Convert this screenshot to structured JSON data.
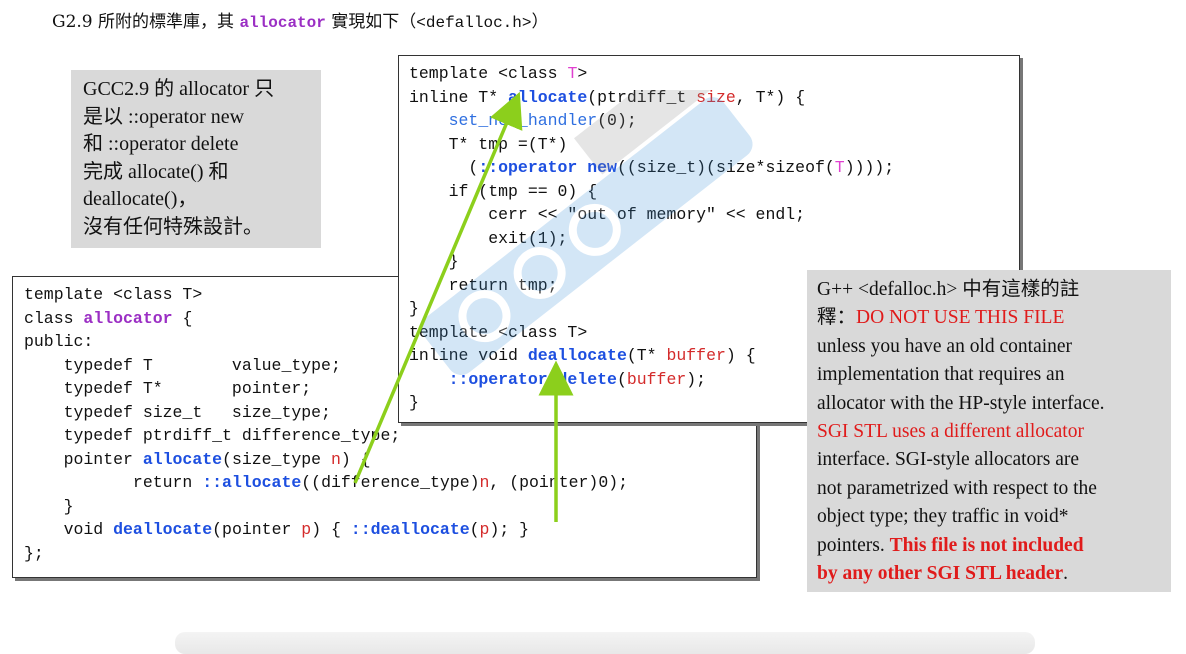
{
  "heading": {
    "prefix": "G2.9 所附的標準庫，其 ",
    "keyword": "allocator",
    "middle": " 實現如下（",
    "file": "<defalloc.h>",
    "suffix": "）"
  },
  "note_left": {
    "lines": [
      "GCC2.9 的 allocator 只",
      "是以 ::operator new",
      "和 ::operator delete",
      "完成 allocate() 和",
      "deallocate()，",
      "沒有任何特殊設計。"
    ]
  },
  "code_top": {
    "tokens": [
      [
        "template <class ",
        "T",
        ">"
      ],
      [
        "inline T* ",
        "allocate",
        "(ptrdiff_t ",
        "size",
        ", T*) {"
      ],
      [
        "    ",
        "set_new_handler",
        "(0);"
      ],
      [
        "    T* tmp =(T*)"
      ],
      [
        "      (",
        "::operator new",
        "((size_t)(size*sizeof(",
        "T",
        "))));"
      ],
      [
        "    if (tmp == 0) {"
      ],
      [
        "        cerr << \"out of memory\" << endl;"
      ],
      [
        "        exit(1);"
      ],
      [
        "    }"
      ],
      [
        "    return tmp;"
      ],
      [
        "}"
      ],
      [
        "template <class T>"
      ],
      [
        "inline void ",
        "deallocate",
        "(T* ",
        "buffer",
        ") {"
      ],
      [
        "    ",
        "::operator delete",
        "(",
        "buffer",
        ");"
      ],
      [
        "}"
      ]
    ]
  },
  "code_bottom": {
    "tokens": [
      [
        "template <class T>"
      ],
      [
        "class ",
        "allocator",
        " {"
      ],
      [
        "public:"
      ],
      [
        "    typedef T        value_type;"
      ],
      [
        "    typedef T*       pointer;"
      ],
      [
        "    typedef size_t   size_type;"
      ],
      [
        "    typedef ptrdiff_t difference_type;"
      ],
      [
        "    pointer ",
        "allocate",
        "(size_type ",
        "n",
        ") {"
      ],
      [
        "           return ",
        "::allocate",
        "((difference_type)",
        "n",
        ", (pointer)0);"
      ],
      [
        "    }"
      ],
      [
        "    void ",
        "deallocate",
        "(pointer ",
        "p",
        ") { ",
        "::deallocate",
        "(",
        "p",
        "); }"
      ],
      [
        "};"
      ]
    ]
  },
  "note_right": {
    "l1": "G++ <defalloc.h> 中有這樣的註",
    "l2a": "釋：",
    "l2b": "DO NOT USE THIS FILE",
    "l3": "unless you have an old container",
    "l4": "implementation that requires an",
    "l5": "allocator with the HP-style interface.",
    "l6": "SGI STL uses a different allocator",
    "l7": "interface.  SGI-style allocators are",
    "l8": "not parametrized with respect to the",
    "l9": "object type; they traffic in void*",
    "l10a": "pointers.  ",
    "l10b": "This file is not included",
    "l11a": "by any other SGI STL header",
    "l11b": "."
  },
  "colors": {
    "arrow": "#8ccf1c",
    "keyword_blue": "#1d4fe0",
    "keyword_purple": "#9b2fc4",
    "param_red": "#d42b2b",
    "note_red": "#e01b1b"
  }
}
